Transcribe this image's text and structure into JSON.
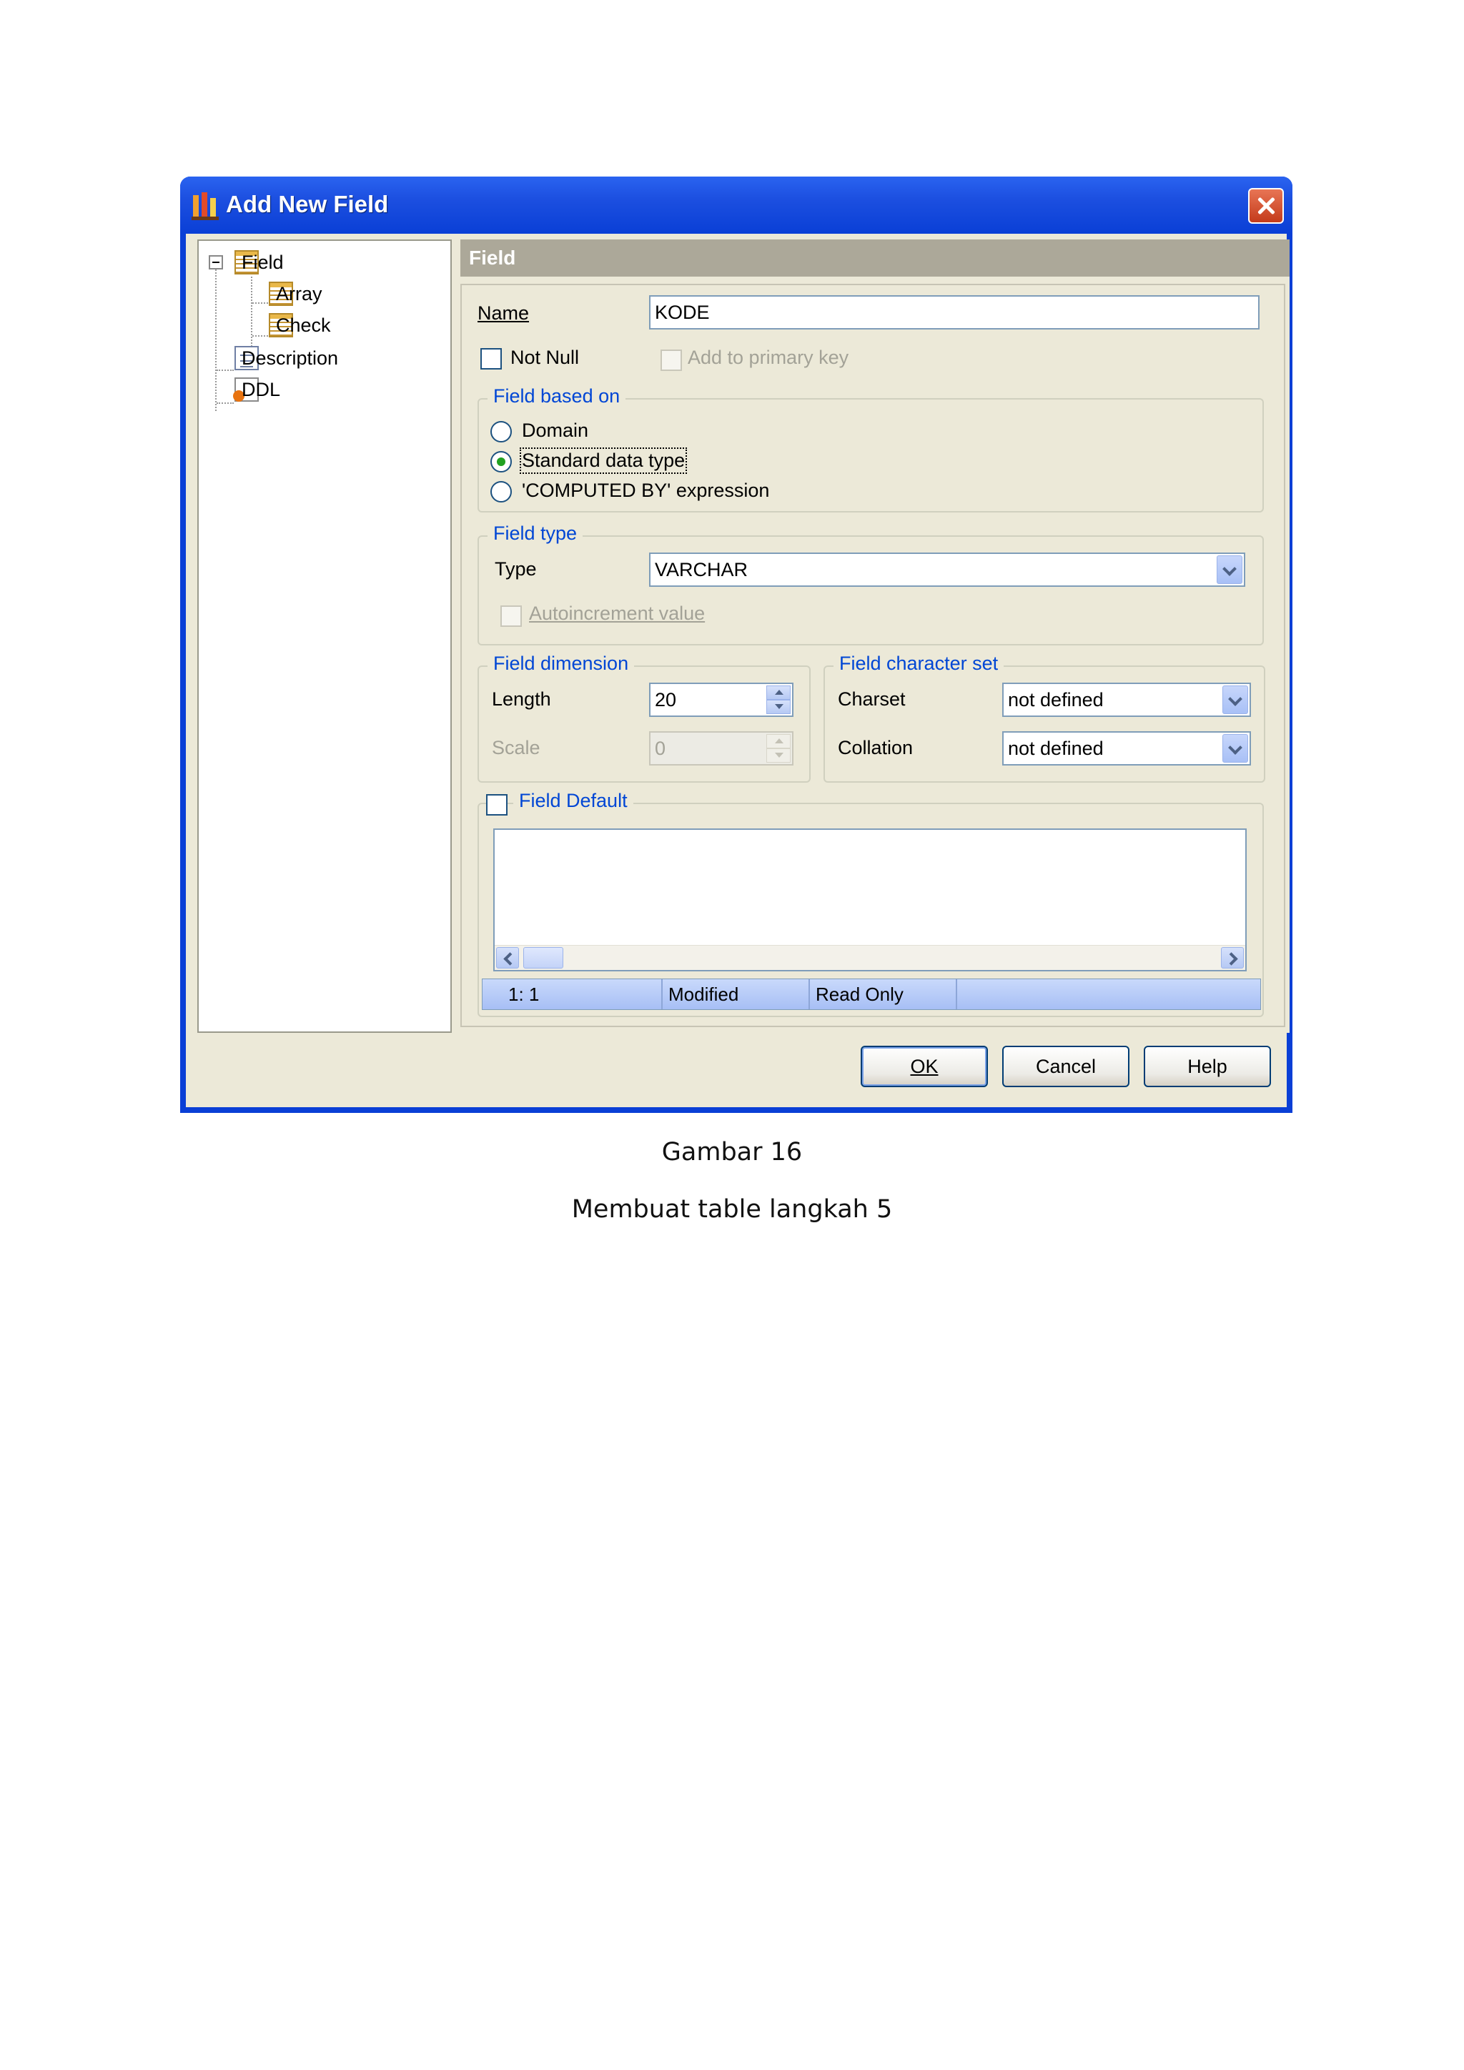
{
  "window": {
    "title": "Add New Field"
  },
  "tree": {
    "items": [
      {
        "label": "Field",
        "icon": "table-grid-icon"
      },
      {
        "label": "Array",
        "icon": "table-grid-icon"
      },
      {
        "label": "Check",
        "icon": "table-grid-icon"
      },
      {
        "label": "Description",
        "icon": "document-icon"
      },
      {
        "label": "DDL",
        "icon": "ddl-script-icon"
      }
    ]
  },
  "panel": {
    "header": "Field",
    "name": {
      "label": "Name",
      "value": "KODE"
    },
    "not_null": {
      "label": "Not Null",
      "checked": false
    },
    "primary_key": {
      "label": "Add to primary key",
      "checked": false,
      "enabled": false
    },
    "field_based_on": {
      "title": "Field based on",
      "options": [
        "Domain",
        "Standard data type",
        "'COMPUTED BY' expression"
      ],
      "selected": "Standard data type"
    },
    "field_type": {
      "title": "Field type",
      "type_label": "Type",
      "type_value": "VARCHAR",
      "autoincrement_label": "Autoincrement value"
    },
    "field_dimension": {
      "title": "Field dimension",
      "length_label": "Length",
      "length_value": "20",
      "scale_label": "Scale",
      "scale_value": "0"
    },
    "field_charset": {
      "title": "Field character set",
      "charset_label": "Charset",
      "charset_value": "not defined",
      "collation_label": "Collation",
      "collation_value": "not defined"
    },
    "field_default": {
      "label": "Field Default",
      "checked": false
    },
    "status": {
      "position": "1:   1",
      "modified": "Modified",
      "mode": "Read Only",
      "extra": ""
    }
  },
  "buttons": {
    "ok": "OK",
    "cancel": "Cancel",
    "help": "Help"
  },
  "caption": {
    "line1": "Gambar 16",
    "line2": "Membuat table langkah 5"
  },
  "colors": {
    "title_bar": "#0a3fd6",
    "group_title": "#0046d5",
    "dialog_bg": "#ece9d8"
  }
}
